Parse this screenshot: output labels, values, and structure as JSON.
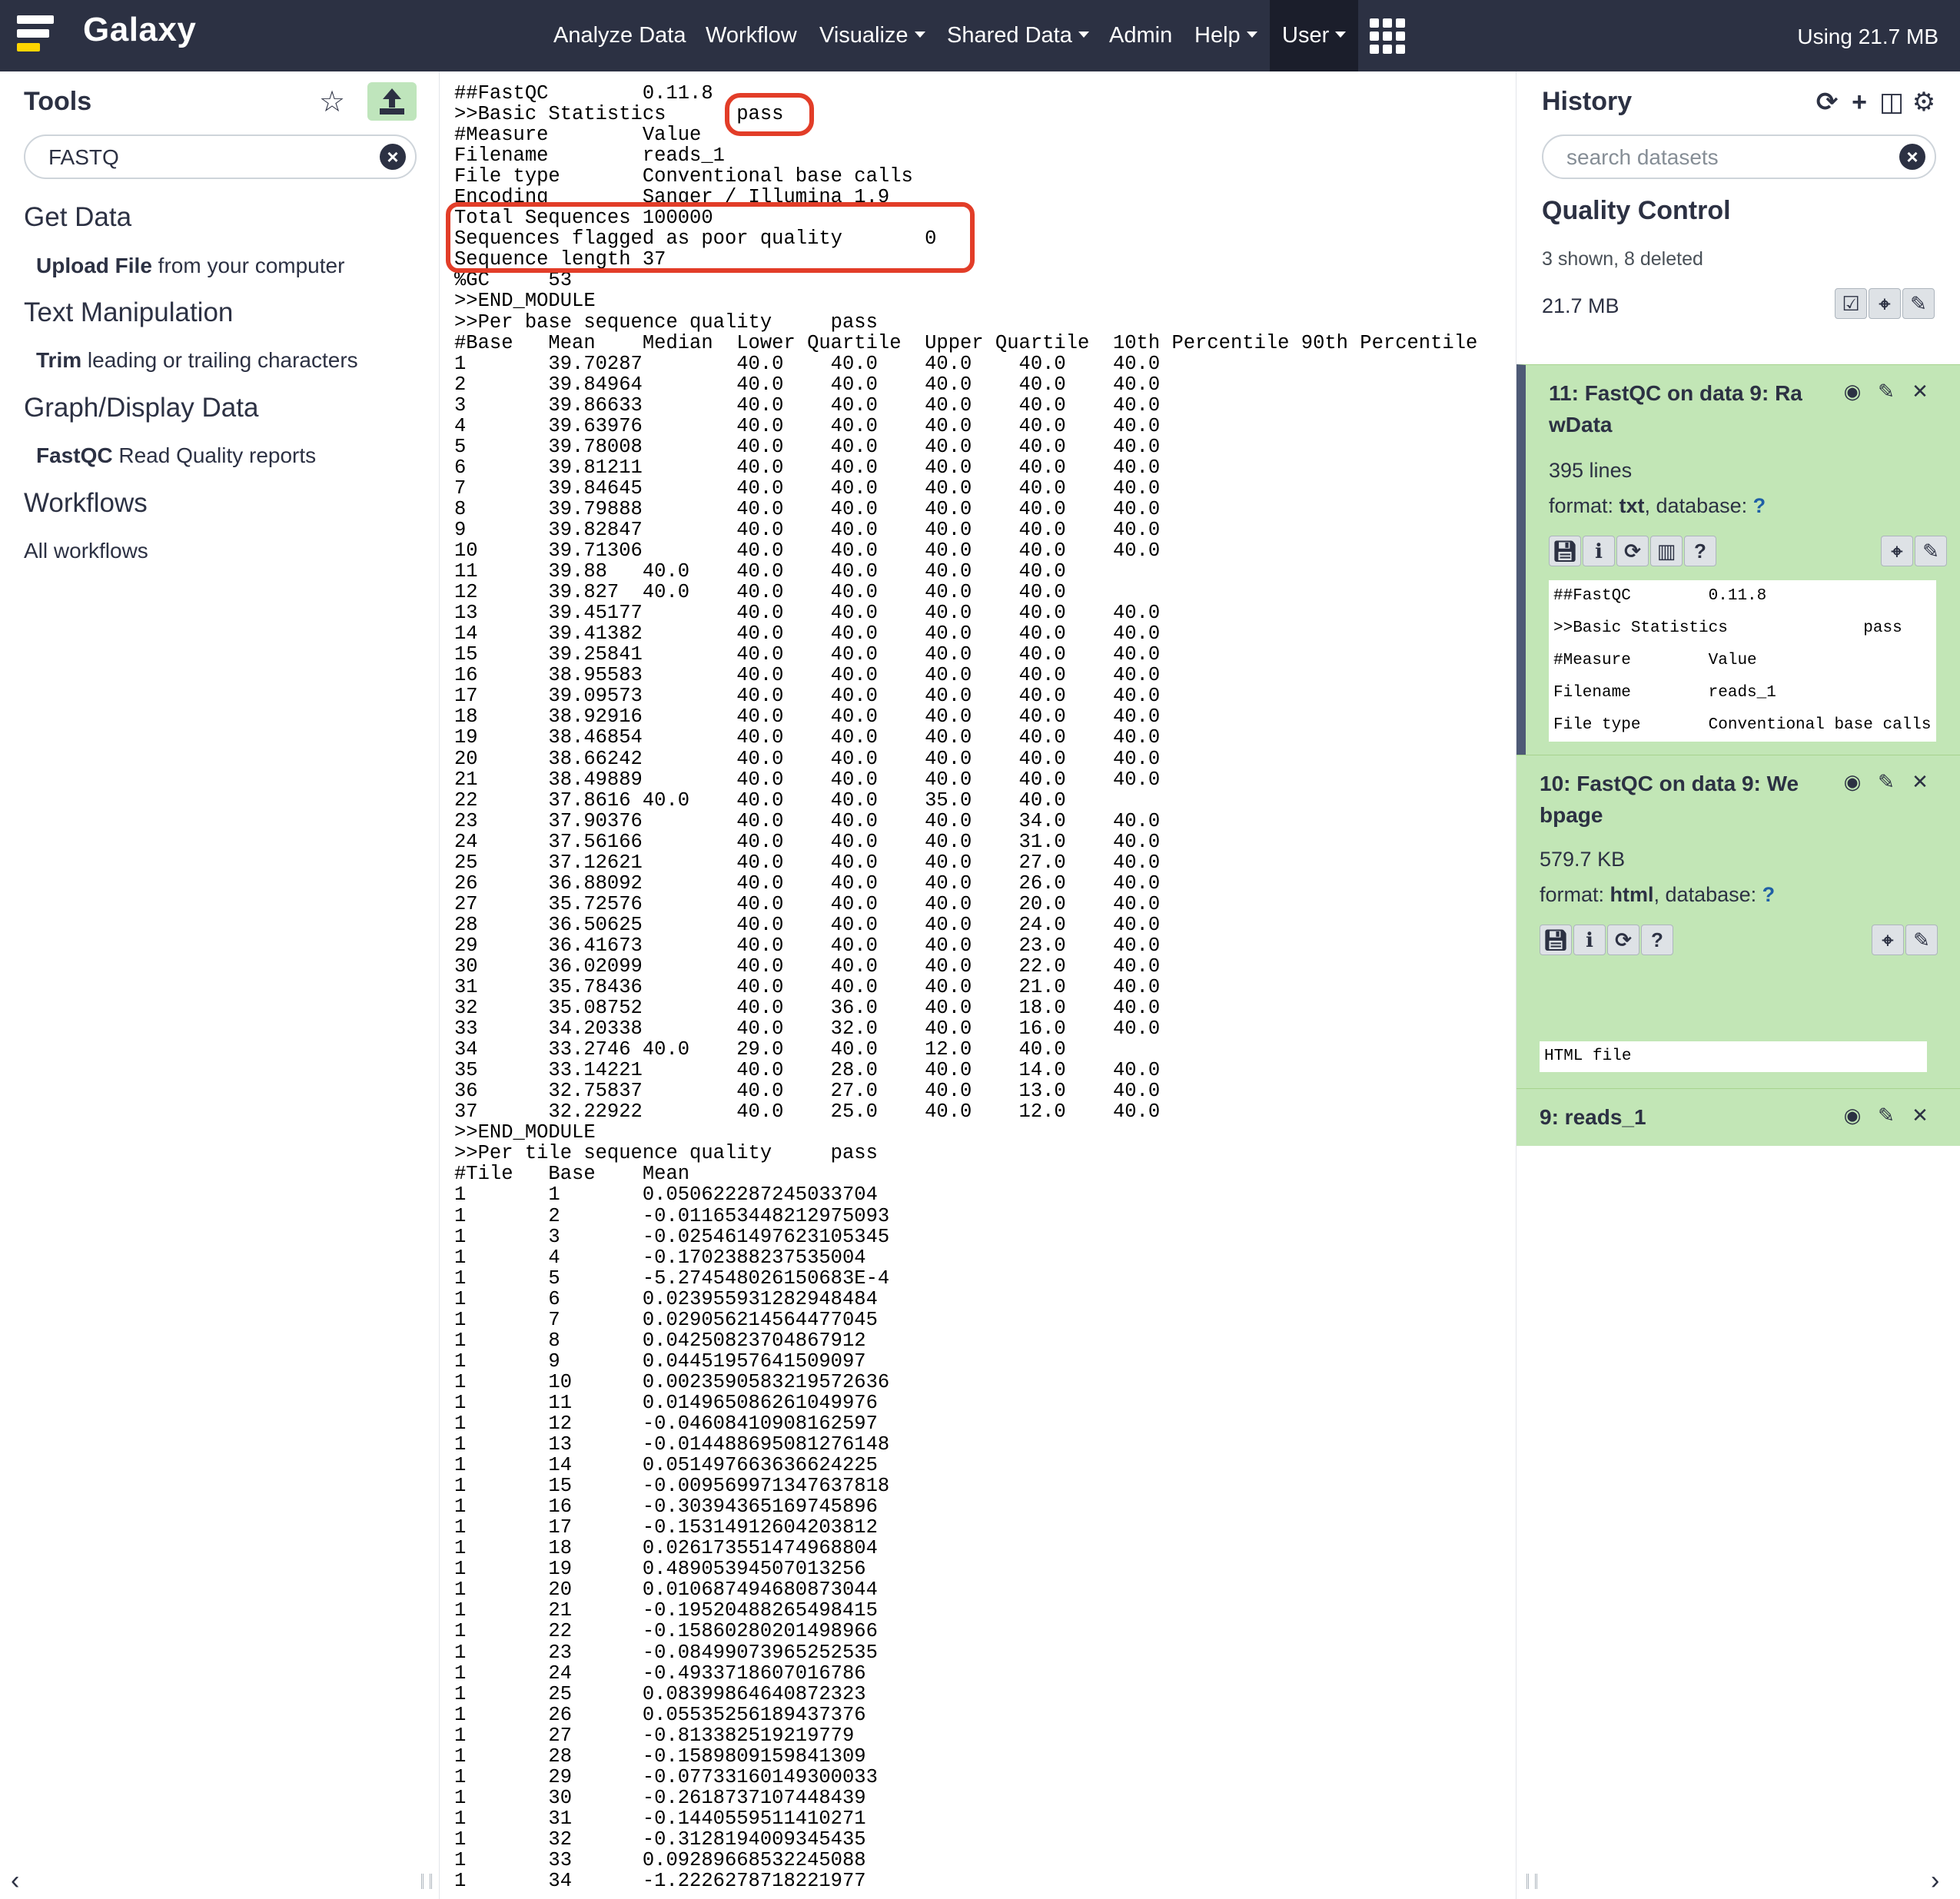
{
  "masthead": {
    "brand": "Galaxy",
    "nav": [
      {
        "label": "Analyze Data",
        "caret": false
      },
      {
        "label": "Workflow",
        "caret": false
      },
      {
        "label": "Visualize",
        "caret": true
      },
      {
        "label": "Shared Data",
        "caret": true
      },
      {
        "label": "Admin",
        "caret": false
      },
      {
        "label": "Help",
        "caret": true
      },
      {
        "label": "User",
        "caret": true
      }
    ],
    "quota": "Using 21.7 MB"
  },
  "tools": {
    "title": "Tools",
    "search_value": "FASTQ",
    "sections": [
      {
        "title": "Get Data",
        "tool_name": "Upload File",
        "tool_desc": " from your computer"
      },
      {
        "title": "Text Manipulation",
        "tool_name": "Trim",
        "tool_desc": " leading or trailing characters"
      },
      {
        "title": "Graph/Display Data",
        "tool_name": "FastQC",
        "tool_desc": " Read Quality reports"
      },
      {
        "title": "Workflows"
      }
    ],
    "workflow_link": "All workflows"
  },
  "report": {
    "lines": [
      "##FastQC\t0.11.8",
      ">>Basic Statistics\tpass",
      "#Measure\tValue",
      "Filename\treads_1",
      "File type\tConventional base calls",
      "Encoding\tSanger / Illumina 1.9",
      "Total Sequences\t100000",
      "Sequences flagged as poor quality\t0",
      "Sequence length\t37",
      "%GC\t53",
      ">>END_MODULE",
      ">>Per base sequence quality\tpass",
      "#Base\tMean\tMedian\tLower Quartile\tUpper Quartile\t10th Percentile\t90th Percentile",
      "1\t39.70287\t40.0\t40.0\t40.0\t40.0\t40.0",
      "2\t39.84964\t40.0\t40.0\t40.0\t40.0\t40.0",
      "3\t39.86633\t40.0\t40.0\t40.0\t40.0\t40.0",
      "4\t39.63976\t40.0\t40.0\t40.0\t40.0\t40.0",
      "5\t39.78008\t40.0\t40.0\t40.0\t40.0\t40.0",
      "6\t39.81211\t40.0\t40.0\t40.0\t40.0\t40.0",
      "7\t39.84645\t40.0\t40.0\t40.0\t40.0\t40.0",
      "8\t39.79888\t40.0\t40.0\t40.0\t40.0\t40.0",
      "9\t39.82847\t40.0\t40.0\t40.0\t40.0\t40.0",
      "10\t39.71306\t40.0\t40.0\t40.0\t40.0\t40.0",
      "11\t39.88\t40.0\t40.0\t40.0\t40.0\t40.0",
      "12\t39.827\t40.0\t40.0\t40.0\t40.0\t40.0",
      "13\t39.45177\t40.0\t40.0\t40.0\t40.0\t40.0",
      "14\t39.41382\t40.0\t40.0\t40.0\t40.0\t40.0",
      "15\t39.25841\t40.0\t40.0\t40.0\t40.0\t40.0",
      "16\t38.95583\t40.0\t40.0\t40.0\t40.0\t40.0",
      "17\t39.09573\t40.0\t40.0\t40.0\t40.0\t40.0",
      "18\t38.92916\t40.0\t40.0\t40.0\t40.0\t40.0",
      "19\t38.46854\t40.0\t40.0\t40.0\t40.0\t40.0",
      "20\t38.66242\t40.0\t40.0\t40.0\t40.0\t40.0",
      "21\t38.49889\t40.0\t40.0\t40.0\t40.0\t40.0",
      "22\t37.8616\t40.0\t40.0\t40.0\t35.0\t40.0",
      "23\t37.90376\t40.0\t40.0\t40.0\t34.0\t40.0",
      "24\t37.56166\t40.0\t40.0\t40.0\t31.0\t40.0",
      "25\t37.12621\t40.0\t40.0\t40.0\t27.0\t40.0",
      "26\t36.88092\t40.0\t40.0\t40.0\t26.0\t40.0",
      "27\t35.72576\t40.0\t40.0\t40.0\t20.0\t40.0",
      "28\t36.50625\t40.0\t40.0\t40.0\t24.0\t40.0",
      "29\t36.41673\t40.0\t40.0\t40.0\t23.0\t40.0",
      "30\t36.02099\t40.0\t40.0\t40.0\t22.0\t40.0",
      "31\t35.78436\t40.0\t40.0\t40.0\t21.0\t40.0",
      "32\t35.08752\t40.0\t36.0\t40.0\t18.0\t40.0",
      "33\t34.20338\t40.0\t32.0\t40.0\t16.0\t40.0",
      "34\t33.2746\t40.0\t29.0\t40.0\t12.0\t40.0",
      "35\t33.14221\t40.0\t28.0\t40.0\t14.0\t40.0",
      "36\t32.75837\t40.0\t27.0\t40.0\t13.0\t40.0",
      "37\t32.22922\t40.0\t25.0\t40.0\t12.0\t40.0",
      ">>END_MODULE",
      ">>Per tile sequence quality\tpass",
      "#Tile\tBase\tMean",
      "1\t1\t0.050622287245033704",
      "1\t2\t-0.011653448212975093",
      "1\t3\t-0.025461497623105345",
      "1\t4\t-0.1702388237535004",
      "1\t5\t-5.274548026150683E-4",
      "1\t6\t0.023955931282948484",
      "1\t7\t0.029056214564477045",
      "1\t8\t0.04250823704867912",
      "1\t9\t0.04451957641509097",
      "1\t10\t0.0023590583219572636",
      "1\t11\t0.014965086261049976",
      "1\t12\t-0.04608410908162597",
      "1\t13\t-0.014488695081276148",
      "1\t14\t0.051497663636624225",
      "1\t15\t-0.009569971347637818",
      "1\t16\t-0.30394365169745896",
      "1\t17\t-0.15314912604203812",
      "1\t18\t0.026173551474968804",
      "1\t19\t0.48905394507013256",
      "1\t20\t0.010687494680873044",
      "1\t21\t-0.19520488265498415",
      "1\t22\t-0.15860280201498966",
      "1\t23\t-0.08499073965252535",
      "1\t24\t-0.4933718607016786",
      "1\t25\t0.08399864640872323",
      "1\t26\t0.05535256189437376",
      "1\t27\t-0.813382519219779",
      "1\t28\t-0.1589809159841309",
      "1\t29\t-0.07733160149300033",
      "1\t30\t-0.2618737107448439",
      "1\t31\t-0.1440559511410271",
      "1\t32\t-0.3128194009345435",
      "1\t33\t0.09289668532245088",
      "1\t34\t-1.2226278718221977"
    ]
  },
  "history": {
    "title": "History",
    "search_placeholder": "search datasets",
    "name": "Quality Control",
    "counts": "3 shown, 8 deleted",
    "size": "21.7 MB",
    "datasets": [
      {
        "title": "11: FastQC on data 9: RawData",
        "title_line1": "11: FastQC on data 9: Ra",
        "title_line2": "wData",
        "lines_info": "395 lines",
        "format_label": "format: ",
        "format": "txt",
        "db_label": ", database: ",
        "db": "?",
        "peek": [
          "##FastQC\t0.11.8",
          ">>Basic Statistics\tpass",
          "#Measure\tValue",
          "Filename\treads_1",
          "File type\tConventional base calls"
        ]
      },
      {
        "title": "10: FastQC on data 9: Webpage",
        "title_line1": "10: FastQC on data 9: We",
        "title_line2": "bpage",
        "size_info": "579.7 KB",
        "format_label": "format: ",
        "format": "html",
        "db_label": ", database: ",
        "db": "?",
        "peek": [
          "HTML file"
        ]
      },
      {
        "title": "9: reads_1"
      }
    ]
  },
  "colors": {
    "masthead": "#2c3143",
    "dataset_ok": "#c2e6b6",
    "highlight": "#e23d28",
    "selected_border": "#4e5a76"
  }
}
